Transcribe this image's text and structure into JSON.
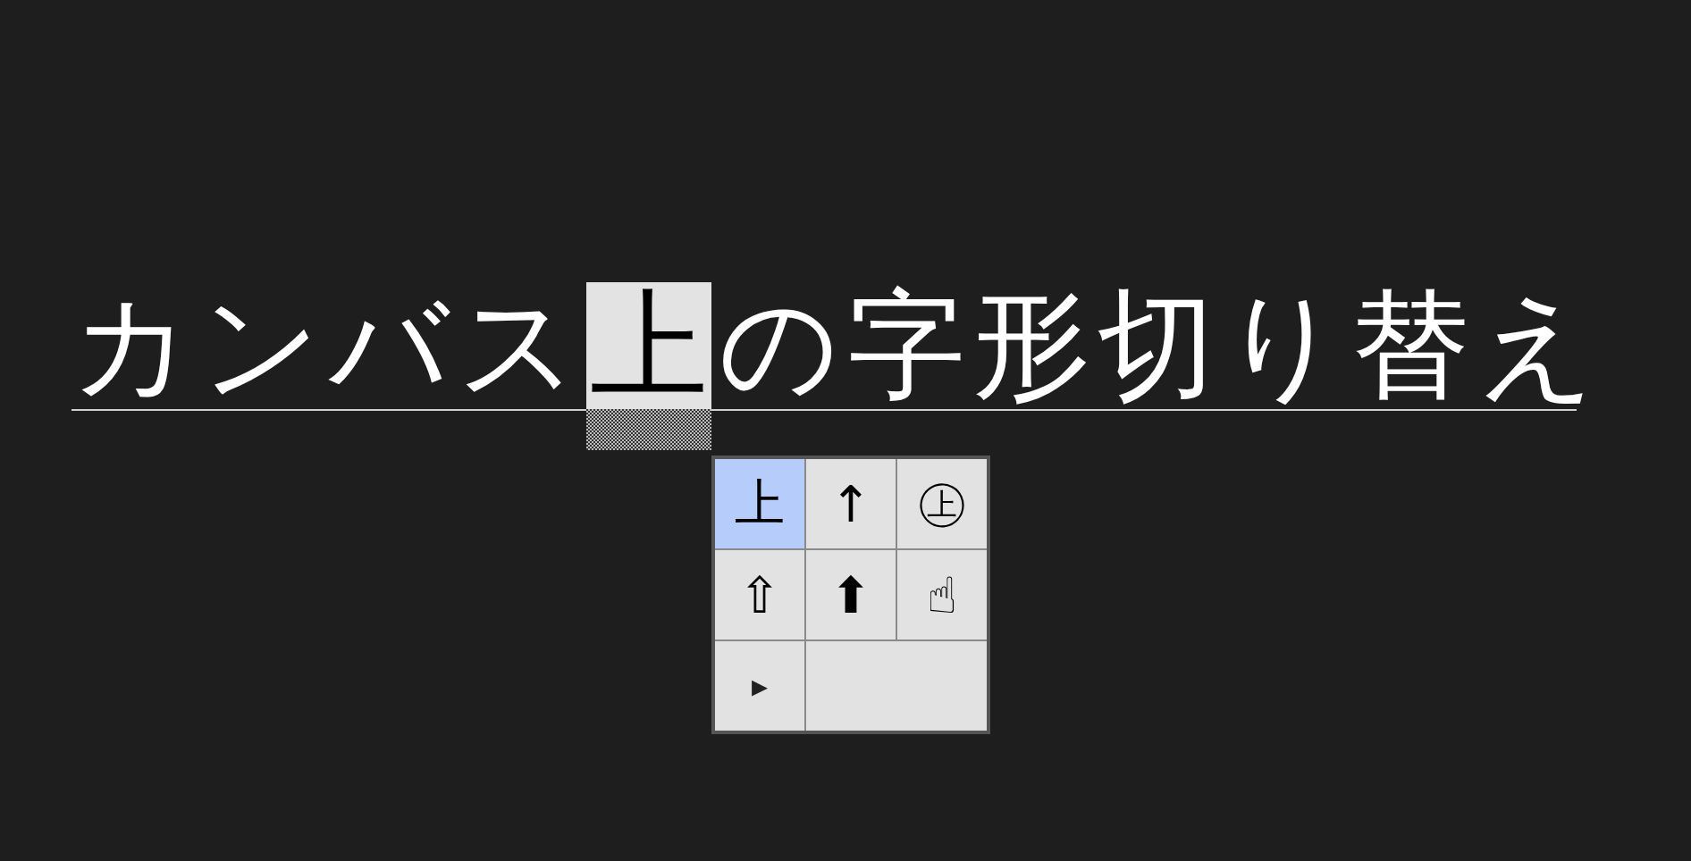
{
  "composition": {
    "before": "カンバス",
    "selected": "上",
    "after": "の字形切り替え"
  },
  "glyph_popup": {
    "candidates": [
      {
        "glyph": "上",
        "selected": true
      },
      {
        "glyph": "↑",
        "selected": false
      },
      {
        "glyph": "㊤",
        "selected": false
      },
      {
        "glyph": "⇧",
        "selected": false
      },
      {
        "glyph": "⬆",
        "selected": false
      },
      {
        "glyph": "☝",
        "selected": false
      }
    ],
    "more_button": "▸"
  }
}
